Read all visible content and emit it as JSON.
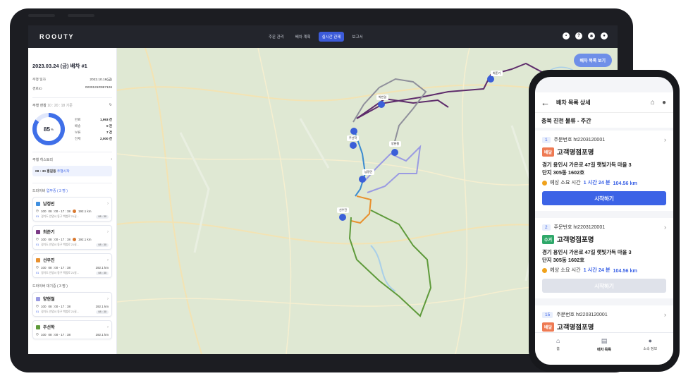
{
  "app": {
    "logo": "ROOUTY",
    "nav": [
      {
        "label": "주문 관리"
      },
      {
        "label": "배차 계획"
      },
      {
        "label": "실시간 관제",
        "active": true
      },
      {
        "label": "보고서"
      }
    ],
    "top_icons": [
      "bell-icon",
      "help-icon",
      "gear-icon",
      "user-icon"
    ]
  },
  "sidebar": {
    "date_title": "2023.03.24 (금) 배차 #1",
    "rows": [
      {
        "label": "주행 일자",
        "value": "2022.10.16(금)"
      },
      {
        "label": "경로ID",
        "value": "0230131R997126"
      }
    ],
    "status_title": "주행 현황",
    "status_time": "10 : 20 : 18 기준",
    "progress_percent": "85",
    "progress_unit": "%",
    "stats": [
      {
        "label": "완료",
        "value": "1,993 건"
      },
      {
        "label": "배송",
        "value": "0 건"
      },
      {
        "label": "보류",
        "value": "7 건"
      },
      {
        "label": "전체",
        "value": "2,000 건"
      }
    ],
    "history_title": "주행 히스토리",
    "history_text": "08 : 30 홍길동",
    "history_action": "주행시작",
    "drivers_active_title": "드라이버",
    "drivers_active_status": "업무중 ( 3 명 )",
    "drivers_waiting_title": "드라이버 대기중 ( 3 명 )",
    "drivers": [
      {
        "name": "남정민",
        "color": "#3f8fe0",
        "count": "100",
        "time": "08 : 00 - 17 : 38",
        "dist": "192.1 km",
        "warn": true,
        "seq": "01",
        "addr": "경기도 안양시 동구 백범로 21길...",
        "tag": "08 : 30"
      },
      {
        "name": "최준기",
        "color": "#7b3a86",
        "count": "100",
        "time": "08 : 00 - 17 : 38",
        "dist": "192.1 km",
        "warn": true,
        "seq": "01",
        "addr": "경기도 안양시 동구 백범로 21길...",
        "tag": "08 : 30"
      },
      {
        "name": "선우진",
        "color": "#e8902e",
        "count": "100",
        "time": "08 : 00 - 17 : 38",
        "dist": "192.1 km",
        "warn": false,
        "seq": "01",
        "addr": "경기도 안양시 동구 백범로 21길...",
        "tag": "08 : 30"
      },
      {
        "name": "양현철",
        "color": "#9a9be2",
        "count": "100",
        "time": "08 : 00 - 17 : 38",
        "dist": "192.1 km",
        "warn": false,
        "seq": "01",
        "addr": "경기도 안양시 동구 백범로 21길...",
        "tag": "08 : 30"
      },
      {
        "name": "주선학",
        "color": "#5e9a3a",
        "count": "100",
        "time": "08 : 00 - 17 : 38",
        "dist": "192.1 km",
        "warn": false
      }
    ]
  },
  "map": {
    "button_label": "배차 목록 보기",
    "markers": [
      "최준기",
      "박빈일",
      "주선학",
      "양현철",
      "남정민",
      "선우진"
    ]
  },
  "phone": {
    "title": "배차 목록 상세",
    "subtitle": "충북 진천 물류 - 주간",
    "order_label": "주문번호",
    "eta_label": "예상 소요 시간",
    "cards": [
      {
        "num": "1",
        "order": "ht2203120001",
        "badge": "배달",
        "badge_color": "#ee7a53",
        "name": "고객명점포명",
        "addr1": "경기 용인시 가온로 47길 햇빛가득 마을 3",
        "addr2": "단지 305동 1602호",
        "time": "1 시간 24 분",
        "dist": "104.56 km",
        "button": "시작하기",
        "disabled": false
      },
      {
        "num": "2",
        "order": "ht2203120001",
        "badge": "수거",
        "badge_color": "#2fa86a",
        "name": "고객명점포명",
        "addr1": "경기 용인시 가온로 47길 햇빛가득 마을 3",
        "addr2": "단지 305동 1602호",
        "time": "1 시간 24 분",
        "dist": "104.56 km",
        "button": "시작하기",
        "disabled": true
      },
      {
        "num": "15",
        "order": "ht2203120001",
        "badge": "배달",
        "badge_color": "#ee7a53",
        "name": "고객명점포명"
      }
    ],
    "tabs": [
      {
        "label": "홈",
        "icon": "home-icon"
      },
      {
        "label": "배차 목록",
        "icon": "list-icon",
        "active": true
      },
      {
        "label": "소속 정보",
        "icon": "person-icon"
      }
    ]
  }
}
